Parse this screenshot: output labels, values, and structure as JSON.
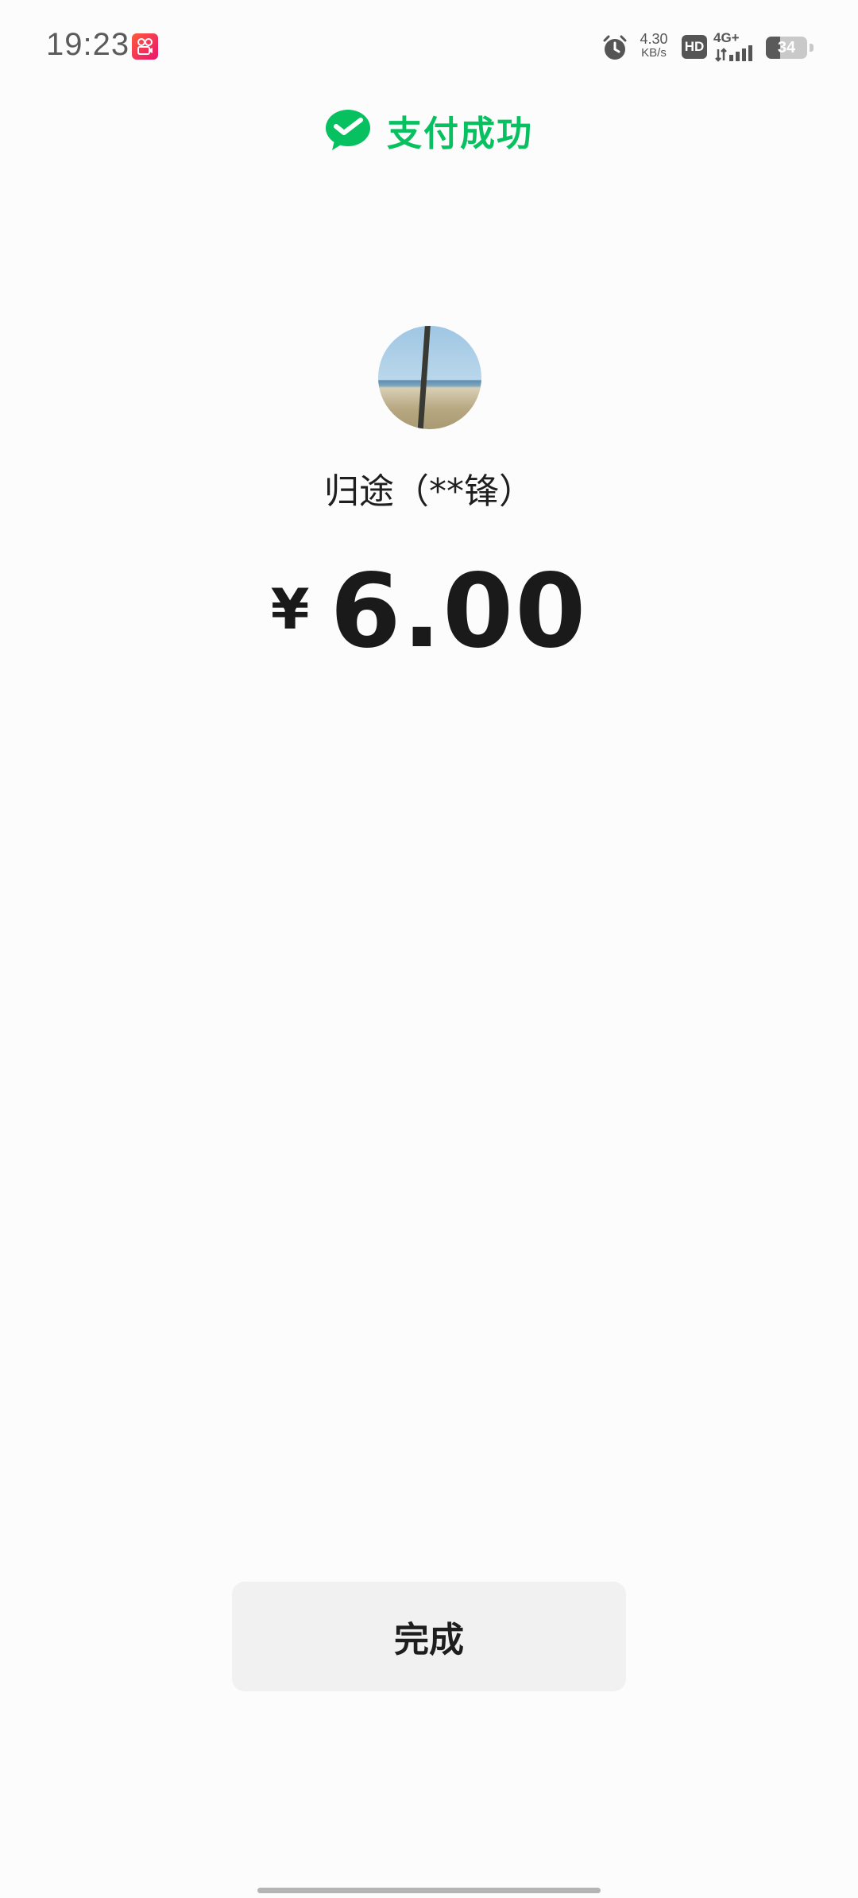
{
  "status_bar": {
    "time": "19:23",
    "network_speed_value": "4.30",
    "network_speed_unit": "KB/s",
    "hd_label": "HD",
    "network_type": "4G+",
    "battery_level": "34",
    "battery_fraction": 0.34,
    "icons": [
      "app-notification-icon",
      "alarm-icon",
      "hd-icon",
      "signal-icon",
      "battery-icon"
    ]
  },
  "header": {
    "icon": "wechat-pay-icon",
    "title": "支付成功",
    "accent_color": "#07c160"
  },
  "payee": {
    "name": "归途（**锋）"
  },
  "payment": {
    "currency_symbol": "¥",
    "amount": "6.00"
  },
  "actions": {
    "done_label": "完成"
  }
}
